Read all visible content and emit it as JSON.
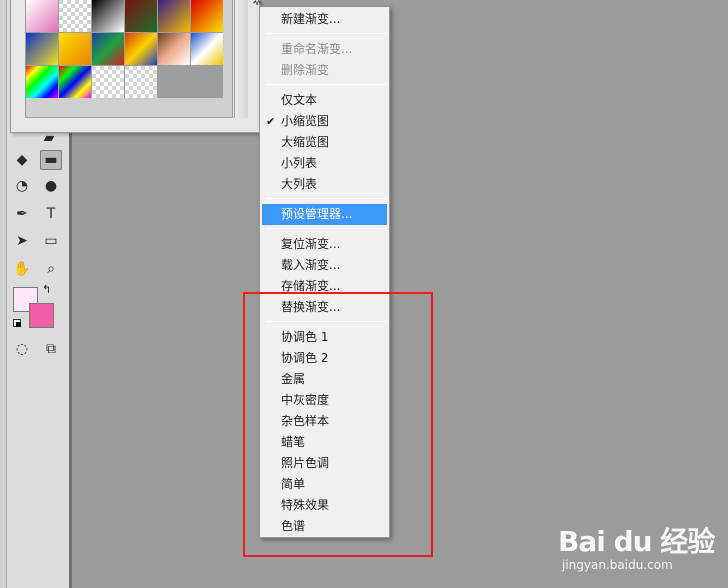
{
  "gradient_picker": {
    "gear_icon": "gear-icon",
    "swatches": [
      "linear-gradient(135deg,#ffffff,#e070b8)",
      "repeating-conic-gradient(#ffffff 0 25%,#d0d0d0 0 50%) 0 0/8px 8px",
      "linear-gradient(135deg,#000000,#ffffff)",
      "linear-gradient(135deg,#7a1212,#1f6f2a)",
      "linear-gradient(135deg,#3b1a8a,#f0c000)",
      "linear-gradient(135deg,#e00000,#f7e200)",
      "linear-gradient(135deg,#1030d0,#f0e020)",
      "linear-gradient(135deg,#f9e000,#f08000)",
      "linear-gradient(135deg,#1b3fa0,#20a040,#d02020)",
      "linear-gradient(135deg,#d04000,#ffd000,#2040c0)",
      "linear-gradient(135deg,#6b3a1f,#f0b090,#ffffff)",
      "linear-gradient(135deg,#2050d0,#ffffff,#f0c000)",
      "linear-gradient(135deg,#ff0000,#ffff00,#00ff00,#00ffff,#0000ff,#ff00ff)",
      "linear-gradient(135deg,#ff0000,#00ff00,#0000ff,#ffff00,#ff00ff)",
      "repeating-conic-gradient(#ffffff 0 25%,#d6d6d6 0 50%) 0 0/8px 8px",
      "repeating-conic-gradient(#ffffff 0 25%,#d6d6d6 0 50%) 0 0/8px 8px"
    ]
  },
  "menu": {
    "groups": [
      [
        {
          "label": "新建渐变...",
          "state": "normal"
        }
      ],
      [
        {
          "label": "重命名渐变...",
          "state": "disabled"
        },
        {
          "label": "删除渐变",
          "state": "disabled"
        }
      ],
      [
        {
          "label": "仅文本",
          "state": "normal"
        },
        {
          "label": "小缩览图",
          "state": "checked"
        },
        {
          "label": "大缩览图",
          "state": "normal"
        },
        {
          "label": "小列表",
          "state": "normal"
        },
        {
          "label": "大列表",
          "state": "normal"
        }
      ],
      [
        {
          "label": "预设管理器...",
          "state": "highlighted"
        }
      ],
      [
        {
          "label": "复位渐变...",
          "state": "normal"
        },
        {
          "label": "载入渐变...",
          "state": "normal"
        },
        {
          "label": "存储渐变...",
          "state": "normal"
        },
        {
          "label": "替换渐变...",
          "state": "normal"
        }
      ],
      [
        {
          "label": "协调色 1",
          "state": "normal"
        },
        {
          "label": "协调色 2",
          "state": "normal"
        },
        {
          "label": "金属",
          "state": "normal"
        },
        {
          "label": "中灰密度",
          "state": "normal"
        },
        {
          "label": "杂色样本",
          "state": "normal"
        },
        {
          "label": "蜡笔",
          "state": "normal"
        },
        {
          "label": "照片色调",
          "state": "normal"
        },
        {
          "label": "简单",
          "state": "normal"
        },
        {
          "label": "特殊效果",
          "state": "normal"
        },
        {
          "label": "色谱",
          "state": "normal"
        }
      ]
    ]
  },
  "toolbar": {
    "tools": [
      {
        "name": "brush-icon",
        "glyph": "▰",
        "active": false
      },
      {
        "name": "eraser-icon",
        "glyph": "◆",
        "active": false
      },
      {
        "name": "gradient-tool-icon",
        "glyph": "▬",
        "active": true
      },
      {
        "name": "blur-icon",
        "glyph": "◔",
        "active": false
      },
      {
        "name": "dodge-icon",
        "glyph": "●",
        "active": false
      },
      {
        "name": "pen-icon",
        "glyph": "✒",
        "active": false
      },
      {
        "name": "type-tool-icon",
        "glyph": "T",
        "active": false
      },
      {
        "name": "path-selection-icon",
        "glyph": "➤",
        "active": false
      },
      {
        "name": "rectangle-icon",
        "glyph": "▭",
        "active": false
      },
      {
        "name": "hand-icon",
        "glyph": "✋",
        "active": false
      },
      {
        "name": "zoom-icon",
        "glyph": "⌕",
        "active": false
      },
      {
        "name": "quick-mask-icon",
        "glyph": "◌",
        "active": false
      },
      {
        "name": "screen-mode-icon",
        "glyph": "⧉",
        "active": false
      }
    ],
    "foreground_color": "#fde8f7",
    "background_color": "#ee5fa5"
  },
  "watermark": {
    "logo": "Bai du 经验",
    "url": "jingyan.baidu.com"
  }
}
